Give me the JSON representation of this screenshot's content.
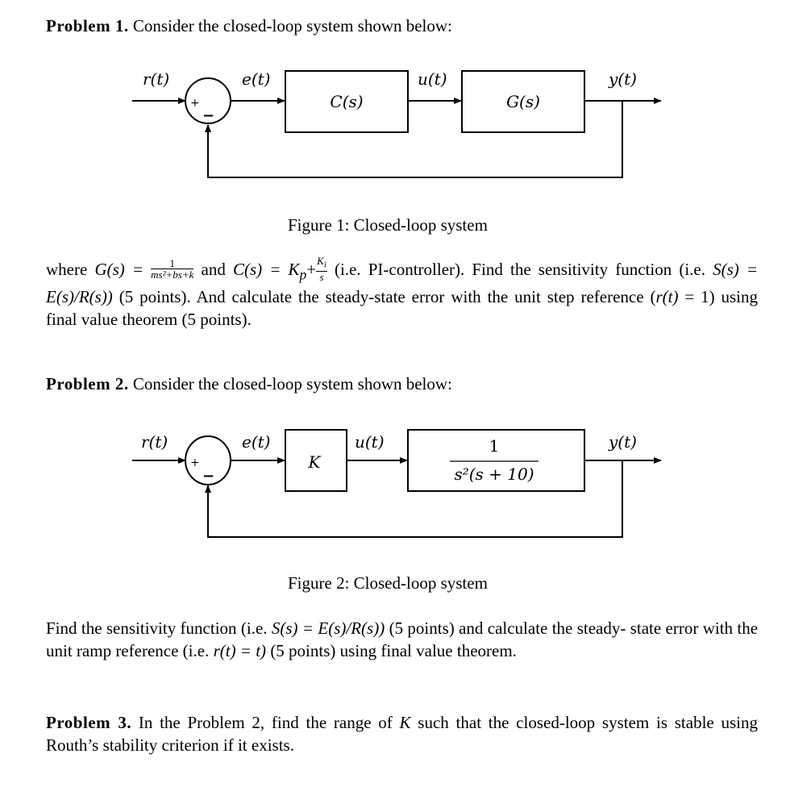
{
  "problem1": {
    "label": "Problem 1.",
    "intro": "Consider the closed-loop system shown below:",
    "figure": {
      "input_label": "r(t)",
      "error_label": "e(t)",
      "controller_block": "C(s)",
      "control_label": "u(t)",
      "plant_block": "G(s)",
      "output_label": "y(t)",
      "sum_plus": "+",
      "sum_minus": "−",
      "caption": "Figure 1: Closed-loop system"
    },
    "text": {
      "where": "where",
      "G_lhs": "G(s) =",
      "G_num": "1",
      "G_den": "ms²+bs+k",
      "and": "and",
      "C_lhs": "C(s) = K",
      "C_sub": "p",
      "C_plus": "+",
      "C_num": "K",
      "C_num_sub": "i",
      "C_den": "s",
      "rest_line1": "(i.e. PI-controller). Find the sensitivity function",
      "line2_a": "(i.e.",
      "line2_math": "S(s) = E(s)/R(s))",
      "line2_b": "(5 points). And calculate the steady-state error with the unit step",
      "line3_a": "reference (",
      "line3_math": "r(t)",
      "line3_b": "= 1) using final value theorem (5 points)."
    }
  },
  "problem2": {
    "label": "Problem 2.",
    "intro": "Consider the closed-loop system shown below:",
    "figure": {
      "input_label": "r(t)",
      "error_label": "e(t)",
      "gain_block": "K",
      "control_label": "u(t)",
      "plant_num": "1",
      "plant_den": "s²(s + 10)",
      "output_label": "y(t)",
      "sum_plus": "+",
      "sum_minus": "−",
      "caption": "Figure 2: Closed-loop system"
    },
    "text": {
      "line1_a": "Find the sensitivity function (i.e.",
      "line1_math": "S(s) = E(s)/R(s))",
      "line1_b": "(5 points) and calculate the steady-",
      "line2_a": "state error with the unit ramp reference (i.e.",
      "line2_math": "r(t) = t)",
      "line2_b": "(5 points) using final value theorem."
    }
  },
  "problem3": {
    "label": "Problem 3.",
    "text_a": "In the Problem 2, find the range of",
    "text_K": "K",
    "text_b": "such that the closed-loop system is stable using Routh’s stability criterion if it exists."
  }
}
